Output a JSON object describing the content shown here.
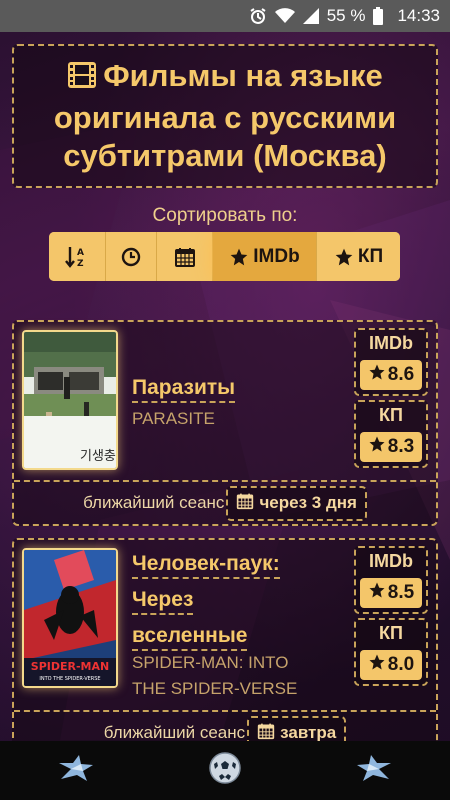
{
  "status": {
    "battery": "55 %",
    "time": "14:33"
  },
  "header": {
    "title": "Фильмы на языке оригинала с русскими субтитрами (Москва)"
  },
  "sort": {
    "label": "Сортировать по:",
    "options": [
      {
        "icon": "sort-alpha-icon",
        "label": ""
      },
      {
        "icon": "clock-icon",
        "label": ""
      },
      {
        "icon": "calendar-icon",
        "label": ""
      },
      {
        "icon": "star-icon",
        "label": "IMDb",
        "active": true
      },
      {
        "icon": "star-icon",
        "label": "КП"
      }
    ]
  },
  "movies": [
    {
      "title": "Паразиты",
      "original": "PARASITE",
      "ratings": [
        {
          "source": "IMDb",
          "value": "8.6"
        },
        {
          "source": "КП",
          "value": "8.3"
        }
      ],
      "session_label": "ближайший сеанс",
      "session_when": "через 3 дня"
    },
    {
      "title_lines": [
        "Человек-паук:",
        "Через",
        "вселенные"
      ],
      "original_lines": [
        "SPIDER-MAN: INTO",
        "THE SPIDER-VERSE"
      ],
      "ratings": [
        {
          "source": "IMDb",
          "value": "8.5"
        },
        {
          "source": "КП",
          "value": "8.0"
        }
      ],
      "session_label": "ближайший сеанс",
      "session_when": "завтра"
    }
  ],
  "colors": {
    "accent": "#f4c66a",
    "border": "#c9a45a",
    "statusbar": "#5a5a5a",
    "navbar": "#0a0a0a"
  }
}
